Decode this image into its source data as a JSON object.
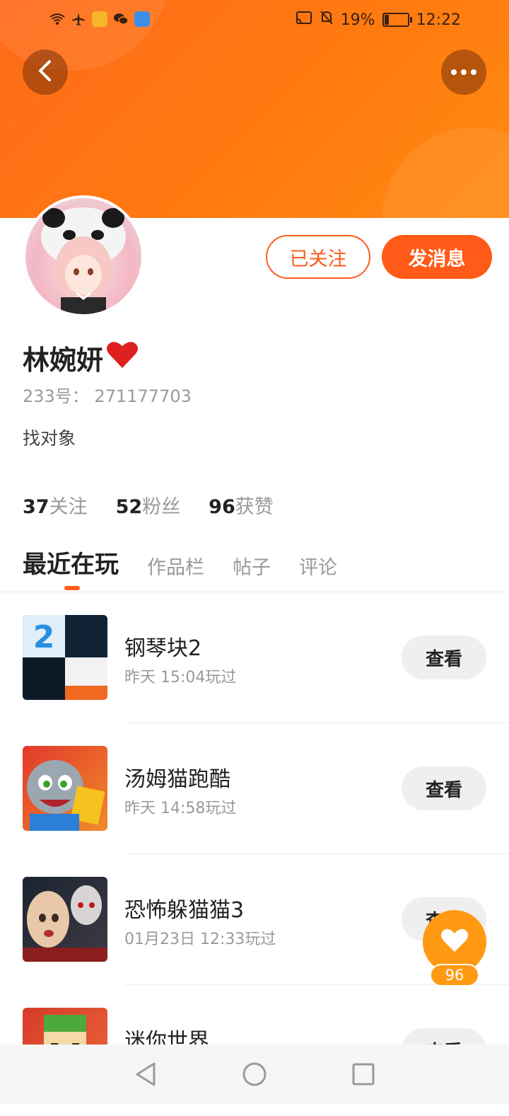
{
  "status_bar": {
    "battery": "19%",
    "time": "12:22"
  },
  "profile": {
    "name": "林婉妍",
    "id_label": "233号：",
    "id_value": "271177703",
    "bio": "找对象",
    "follow_label": "已关注",
    "message_label": "发消息"
  },
  "stats": [
    {
      "value": "37",
      "label": "关注"
    },
    {
      "value": "52",
      "label": "粉丝"
    },
    {
      "value": "96",
      "label": "获赞"
    }
  ],
  "tabs": [
    {
      "label": "最近在玩",
      "active": true
    },
    {
      "label": "作品栏",
      "active": false
    },
    {
      "label": "帖子",
      "active": false
    },
    {
      "label": "评论",
      "active": false
    }
  ],
  "games": [
    {
      "name": "钢琴块2",
      "time": "昨天 15:04玩过",
      "button": "查看"
    },
    {
      "name": "汤姆猫跑酷",
      "time": "昨天 14:58玩过",
      "button": "查看"
    },
    {
      "name": "恐怖躲猫猫3",
      "time": "01月23日 12:33玩过",
      "button": "查看"
    },
    {
      "name": "迷你世界",
      "time": "",
      "button": "查看"
    }
  ],
  "like_fab": {
    "count": "96"
  },
  "colors": {
    "accent": "#ff5a17",
    "header": "#ff7a10",
    "fab": "#ff9a12"
  }
}
